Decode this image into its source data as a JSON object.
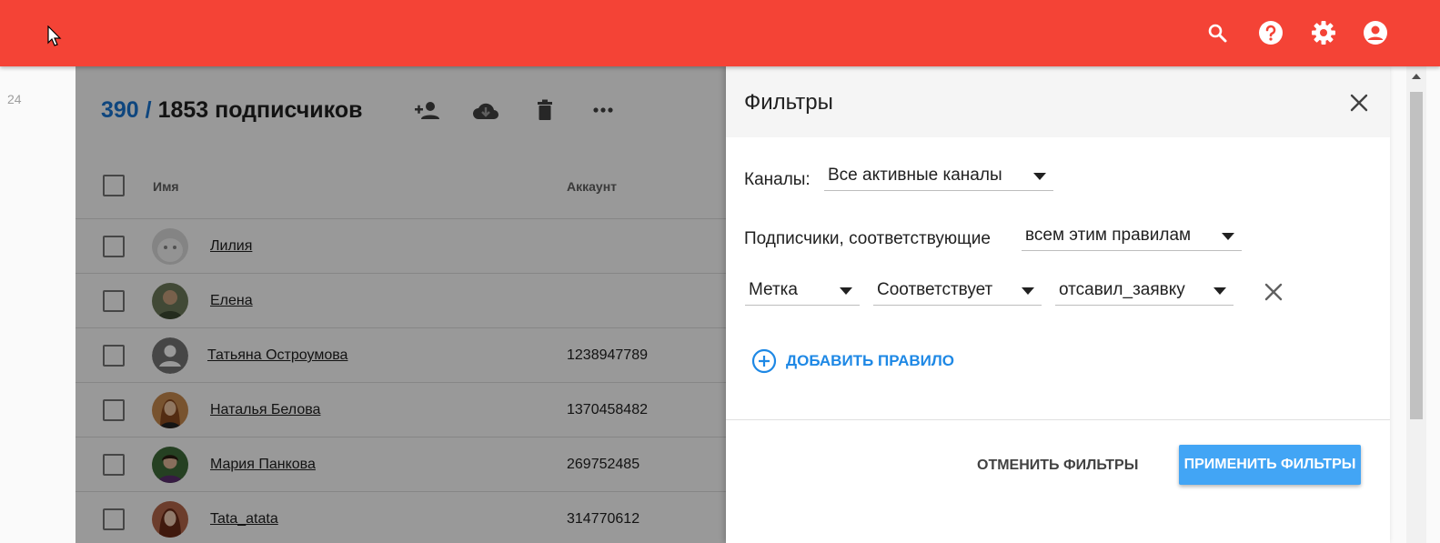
{
  "header": {
    "icons": [
      "search-icon",
      "help-icon",
      "settings-icon",
      "account-icon"
    ]
  },
  "gutter": {
    "line_number": "24"
  },
  "list": {
    "count_selected": "390 /",
    "count_total": "1853 подписчиков",
    "toolbar_icons": [
      "add-person-icon",
      "cloud-download-icon",
      "trash-icon",
      "more-icon"
    ],
    "columns": {
      "name": "Имя",
      "account": "Аккаунт"
    },
    "rows": [
      {
        "name": "Лилия",
        "account": ""
      },
      {
        "name": "Елена",
        "account": ""
      },
      {
        "name": "Татьяна Остроумова",
        "account": "1238947789"
      },
      {
        "name": "Наталья Белова",
        "account": "1370458482"
      },
      {
        "name": "Мария Панкова",
        "account": "269752485"
      },
      {
        "name": "Tata_atata",
        "account": "314770612"
      }
    ]
  },
  "filters": {
    "title": "Фильтры",
    "channels_label": "Каналы:",
    "channels_value": "Все активные каналы",
    "match_label": "Подписчики, соответствующие",
    "match_value": "всем этим правилам",
    "rule": {
      "field": "Метка",
      "operator": "Соответствует",
      "value": "отсавил_заявку"
    },
    "add_rule": "ДОБАВИТЬ ПРАВИЛО",
    "cancel": "ОТМЕНИТЬ ФИЛЬТРЫ",
    "apply": "ПРИМЕНИТЬ ФИЛЬТРЫ"
  },
  "colors": {
    "brand": "#f44336",
    "accent": "#1e88e5",
    "apply_button": "#42a5f5"
  }
}
